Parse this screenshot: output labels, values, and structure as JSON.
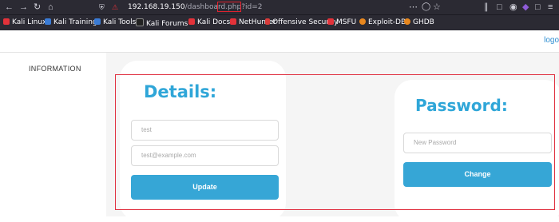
{
  "browser": {
    "url_host": "192.168.19.150",
    "url_path": "/dashboard.php",
    "url_query": "?id=2",
    "bookmarks": [
      {
        "label": "Kali Linux",
        "color": "#e3323a"
      },
      {
        "label": "Kali Training",
        "color": "#3a7bd5"
      },
      {
        "label": "Kali Tools",
        "color": "#3a7bd5"
      },
      {
        "label": "Kali Forums",
        "color": "#222222"
      },
      {
        "label": "Kali Docs",
        "color": "#e3323a"
      },
      {
        "label": "NetHunter",
        "color": "#e3323a"
      },
      {
        "label": "Offensive Security",
        "color": "#d73a3a"
      },
      {
        "label": "MSFU",
        "color": "#e3323a"
      },
      {
        "label": "Exploit-DB",
        "color": "#e8871e"
      },
      {
        "label": "GHDB",
        "color": "#e8871e"
      }
    ]
  },
  "header": {
    "logout_label": "logo"
  },
  "sidebar": {
    "items": [
      {
        "label": "INFORMATION"
      }
    ]
  },
  "details": {
    "title": "Details:",
    "name_placeholder": "test",
    "email_placeholder": "test@example.com",
    "button_label": "Update"
  },
  "password": {
    "title": "Password:",
    "placeholder": "New Password",
    "button_label": "Change"
  },
  "colors": {
    "accent": "#36a6d6",
    "title": "#2fa6d8",
    "highlight": "#e03040"
  }
}
